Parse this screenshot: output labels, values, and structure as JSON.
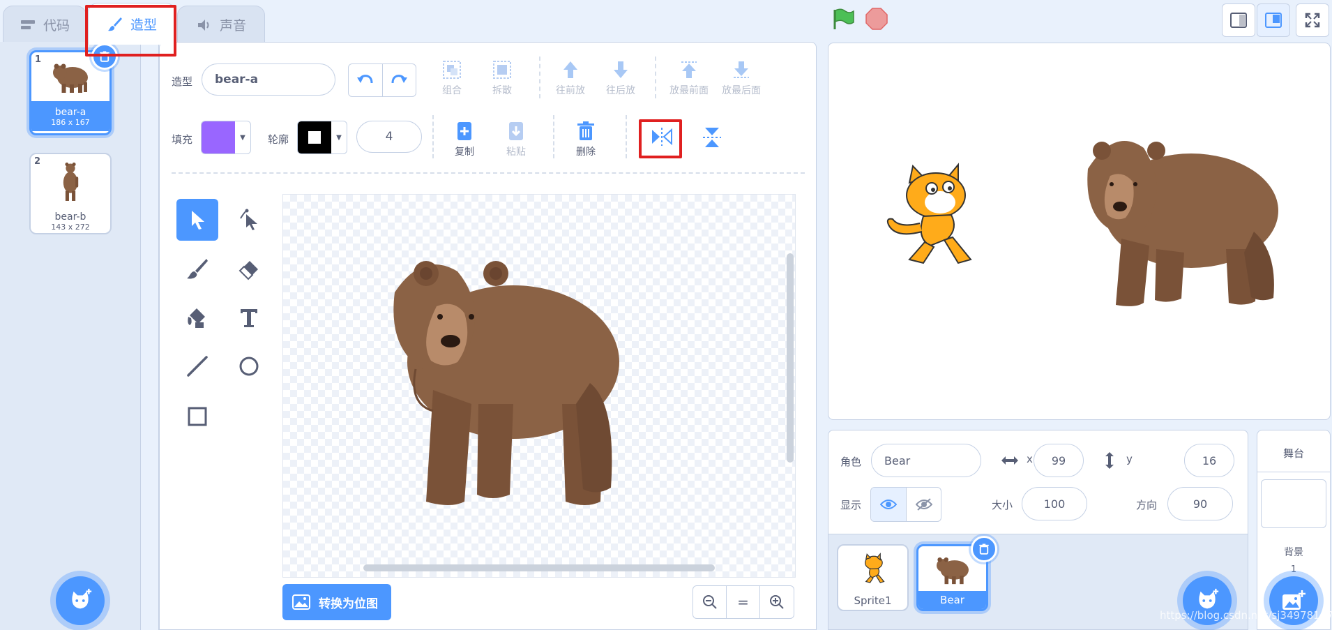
{
  "tabs": [
    {
      "label": "代码",
      "icon": "code-icon"
    },
    {
      "label": "造型",
      "icon": "brush-icon"
    },
    {
      "label": "声音",
      "icon": "sound-icon"
    }
  ],
  "costumes": [
    {
      "index": "1",
      "name": "bear-a",
      "size": "186 x 167",
      "selected": true
    },
    {
      "index": "2",
      "name": "bear-b",
      "size": "143 x 272",
      "selected": false
    }
  ],
  "editor": {
    "costume_label": "造型",
    "costume_name": "bear-a",
    "fill_label": "填充",
    "fill_color": "#9966ff",
    "outline_label": "轮廓",
    "outline_color": "#000000",
    "outline_width": "4",
    "group_label": "组合",
    "ungroup_label": "拆散",
    "forward_label": "往前放",
    "backward_label": "往后放",
    "front_label": "放最前面",
    "back_label": "放最后面",
    "copy_label": "复制",
    "paste_label": "粘贴",
    "delete_label": "删除",
    "convert_label": "转换为位图",
    "zoom_reset": "="
  },
  "sprite": {
    "sprite_label": "角色",
    "name": "Bear",
    "x_label": "x",
    "x_value": "99",
    "y_label": "y",
    "y_value": "16",
    "show_label": "显示",
    "size_label": "大小",
    "size_value": "100",
    "direction_label": "方向",
    "direction_value": "90"
  },
  "sprites": [
    {
      "name": "Sprite1"
    },
    {
      "name": "Bear"
    }
  ],
  "stage_panel": {
    "title": "舞台",
    "backdrop_label": "背景",
    "backdrop_count": "1"
  },
  "watermark": "https://blog.csdn.net/sj349781478",
  "colors": {
    "accent": "#4c97ff",
    "highlight": "#e02020",
    "bear": "#8b6245"
  }
}
